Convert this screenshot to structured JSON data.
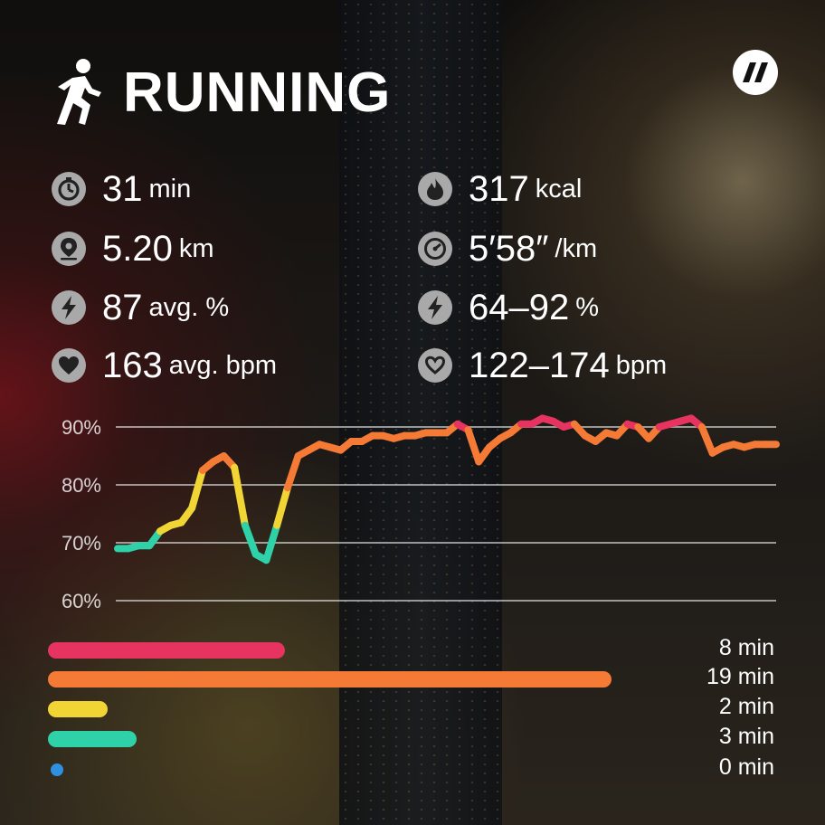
{
  "header": {
    "title": "RUNNING",
    "activity_icon": "running-person-icon",
    "brand_icon": "double-slash-logo-icon"
  },
  "stats": [
    {
      "icon": "stopwatch-icon",
      "value": "31",
      "unit": "min"
    },
    {
      "icon": "flame-icon",
      "value": "317",
      "unit": "kcal"
    },
    {
      "icon": "location-pin-icon",
      "value": "5.20",
      "unit": "km"
    },
    {
      "icon": "speedometer-icon",
      "value": "5′58″",
      "unit": "/km"
    },
    {
      "icon": "lightning-icon",
      "value": "87",
      "unit": "avg. %"
    },
    {
      "icon": "lightning-icon",
      "value": "64–92",
      "unit": "%"
    },
    {
      "icon": "heart-icon",
      "value": "163",
      "unit": "avg. bpm"
    },
    {
      "icon": "heart-outline-icon",
      "value": "122–174",
      "unit": "bpm"
    }
  ],
  "chart_data": {
    "type": "line",
    "ylim": [
      60,
      92
    ],
    "y_ticks": [
      "90%",
      "80%",
      "70%",
      "60%"
    ],
    "y_tick_values": [
      90,
      80,
      70,
      60
    ],
    "grid": true,
    "x": [
      0,
      0.5,
      1,
      1.5,
      2,
      2.5,
      3,
      3.5,
      4,
      4.5,
      5,
      5.5,
      6,
      6.5,
      7,
      7.5,
      8,
      8.5,
      9,
      9.5,
      10,
      10.5,
      11,
      11.5,
      12,
      12.5,
      13,
      13.5,
      14,
      14.5,
      15,
      15.5,
      16,
      16.5,
      17,
      17.5,
      18,
      18.5,
      19,
      19.5,
      20,
      20.5,
      21,
      21.5,
      22,
      22.5,
      23,
      23.5,
      24,
      24.5,
      25,
      25.5,
      26,
      26.5,
      27,
      27.5,
      28,
      28.5,
      29,
      29.5,
      30,
      30.5,
      31
    ],
    "values": [
      69,
      69,
      69.5,
      69.5,
      72,
      73,
      73.5,
      76,
      82.5,
      84,
      85,
      83,
      73,
      68,
      67,
      73,
      79.5,
      85,
      86,
      87,
      86.5,
      86,
      87.5,
      87.5,
      88.5,
      88.5,
      88,
      88.5,
      88.5,
      89,
      89,
      89,
      90.5,
      89.5,
      84,
      86.5,
      88,
      89,
      90.5,
      90.5,
      91.5,
      91,
      90,
      90.5,
      88.5,
      87.5,
      89,
      88.5,
      90.5,
      90,
      88,
      90,
      90.5,
      91,
      91.5,
      90,
      85.5,
      86.5,
      87,
      86.5,
      87,
      87,
      87
    ],
    "zone_colors": {
      "90": "#e6335f",
      "80": "#f47a35",
      "72": "#f1d534",
      "0": "#2fd1a8"
    }
  },
  "zones": [
    {
      "label": "8 min",
      "minutes": 8,
      "color": "#e6335f"
    },
    {
      "label": "19 min",
      "minutes": 19,
      "color": "#f47a35"
    },
    {
      "label": "2 min",
      "minutes": 2,
      "color": "#f1d534"
    },
    {
      "label": "3 min",
      "minutes": 3,
      "color": "#2fd1a8"
    },
    {
      "label": "0 min",
      "minutes": 0,
      "color": "#2f8fe0"
    }
  ]
}
